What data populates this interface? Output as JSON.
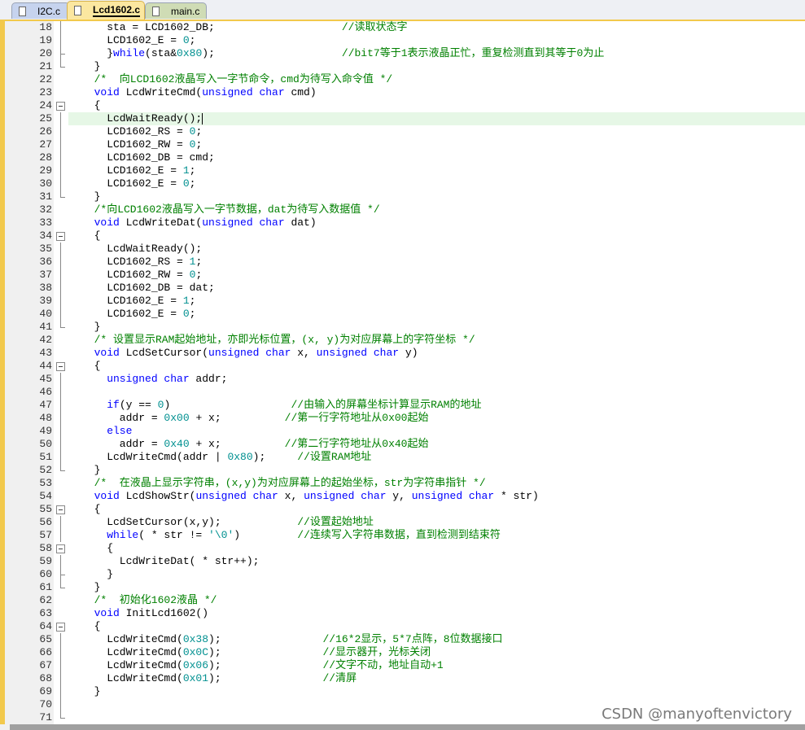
{
  "tabs": [
    {
      "label": "I2C.c",
      "icon": "file-icon"
    },
    {
      "label": "Lcd1602.c",
      "icon": "file-icon",
      "active": true
    },
    {
      "label": "main.c",
      "icon": "file-icon"
    }
  ],
  "colors": {
    "keyword": "#0000ff",
    "number": "#009090",
    "comment": "#008000",
    "current_line": "#e6f7e6",
    "accent": "#f2c94c"
  },
  "editor": {
    "current_line": 25,
    "lines": [
      {
        "n": 18,
        "f": "bar",
        "t": [
          [
            "n",
            "    sta = LCD1602_DB;                    "
          ],
          [
            "c",
            "//读取状态字"
          ]
        ]
      },
      {
        "n": 19,
        "f": "bar",
        "t": [
          [
            "n",
            "    LCD1602_E = "
          ],
          [
            "d",
            "0"
          ],
          [
            "n",
            ";"
          ]
        ]
      },
      {
        "n": 20,
        "f": "tick",
        "t": [
          [
            "n",
            "    }"
          ],
          [
            "k",
            "while"
          ],
          [
            "n",
            "(sta&"
          ],
          [
            "d",
            "0x80"
          ],
          [
            "n",
            ");                    "
          ],
          [
            "c",
            "//bit7等于1表示液晶正忙，重复检测直到其等于0为止"
          ]
        ]
      },
      {
        "n": 21,
        "f": "end",
        "t": [
          [
            "n",
            "  }"
          ]
        ]
      },
      {
        "n": 22,
        "f": "",
        "t": [
          [
            "c",
            "  /*  向LCD1602液晶写入一字节命令，cmd为待写入命令值 */"
          ]
        ]
      },
      {
        "n": 23,
        "f": "",
        "t": [
          [
            "k",
            "  void"
          ],
          [
            "n",
            " LcdWriteCmd("
          ],
          [
            "k",
            "unsigned char"
          ],
          [
            "n",
            " cmd)"
          ]
        ]
      },
      {
        "n": 24,
        "f": "minus",
        "t": [
          [
            "n",
            "  {"
          ]
        ]
      },
      {
        "n": 25,
        "f": "bar",
        "t": [
          [
            "n",
            "    LcdWaitReady();"
          ]
        ],
        "caret": true
      },
      {
        "n": 26,
        "f": "bar",
        "t": [
          [
            "n",
            "    LCD1602_RS = "
          ],
          [
            "d",
            "0"
          ],
          [
            "n",
            ";"
          ]
        ]
      },
      {
        "n": 27,
        "f": "bar",
        "t": [
          [
            "n",
            "    LCD1602_RW = "
          ],
          [
            "d",
            "0"
          ],
          [
            "n",
            ";"
          ]
        ]
      },
      {
        "n": 28,
        "f": "bar",
        "t": [
          [
            "n",
            "    LCD1602_DB = cmd;"
          ]
        ]
      },
      {
        "n": 29,
        "f": "bar",
        "t": [
          [
            "n",
            "    LCD1602_E = "
          ],
          [
            "d",
            "1"
          ],
          [
            "n",
            ";"
          ]
        ]
      },
      {
        "n": 30,
        "f": "bar",
        "t": [
          [
            "n",
            "    LCD1602_E = "
          ],
          [
            "d",
            "0"
          ],
          [
            "n",
            ";"
          ]
        ]
      },
      {
        "n": 31,
        "f": "end",
        "t": [
          [
            "n",
            "  }"
          ]
        ]
      },
      {
        "n": 32,
        "f": "",
        "t": [
          [
            "c",
            "  /*向LCD1602液晶写入一字节数据，dat为待写入数据值 */"
          ]
        ]
      },
      {
        "n": 33,
        "f": "",
        "t": [
          [
            "k",
            "  void"
          ],
          [
            "n",
            " LcdWriteDat("
          ],
          [
            "k",
            "unsigned char"
          ],
          [
            "n",
            " dat)"
          ]
        ]
      },
      {
        "n": 34,
        "f": "minus",
        "t": [
          [
            "n",
            "  {"
          ]
        ]
      },
      {
        "n": 35,
        "f": "bar",
        "t": [
          [
            "n",
            "    LcdWaitReady();"
          ]
        ]
      },
      {
        "n": 36,
        "f": "bar",
        "t": [
          [
            "n",
            "    LCD1602_RS = "
          ],
          [
            "d",
            "1"
          ],
          [
            "n",
            ";"
          ]
        ]
      },
      {
        "n": 37,
        "f": "bar",
        "t": [
          [
            "n",
            "    LCD1602_RW = "
          ],
          [
            "d",
            "0"
          ],
          [
            "n",
            ";"
          ]
        ]
      },
      {
        "n": 38,
        "f": "bar",
        "t": [
          [
            "n",
            "    LCD1602_DB = dat;"
          ]
        ]
      },
      {
        "n": 39,
        "f": "bar",
        "t": [
          [
            "n",
            "    LCD1602_E = "
          ],
          [
            "d",
            "1"
          ],
          [
            "n",
            ";"
          ]
        ]
      },
      {
        "n": 40,
        "f": "bar",
        "t": [
          [
            "n",
            "    LCD1602_E = "
          ],
          [
            "d",
            "0"
          ],
          [
            "n",
            ";"
          ]
        ]
      },
      {
        "n": 41,
        "f": "end",
        "t": [
          [
            "n",
            "  }"
          ]
        ]
      },
      {
        "n": 42,
        "f": "",
        "t": [
          [
            "c",
            "  /* 设置显示RAM起始地址，亦即光标位置，(x, y)为对应屏幕上的字符坐标 */"
          ]
        ]
      },
      {
        "n": 43,
        "f": "",
        "t": [
          [
            "k",
            "  void"
          ],
          [
            "n",
            " LcdSetCursor("
          ],
          [
            "k",
            "unsigned char"
          ],
          [
            "n",
            " x, "
          ],
          [
            "k",
            "unsigned char"
          ],
          [
            "n",
            " y)"
          ]
        ]
      },
      {
        "n": 44,
        "f": "minus",
        "t": [
          [
            "n",
            "  {"
          ]
        ]
      },
      {
        "n": 45,
        "f": "bar",
        "t": [
          [
            "k",
            "    unsigned char"
          ],
          [
            "n",
            " addr;"
          ]
        ]
      },
      {
        "n": 46,
        "f": "bar",
        "t": [
          [
            "n",
            ""
          ]
        ]
      },
      {
        "n": 47,
        "f": "bar",
        "t": [
          [
            "k",
            "    if"
          ],
          [
            "n",
            "(y == "
          ],
          [
            "d",
            "0"
          ],
          [
            "n",
            ")                   "
          ],
          [
            "c",
            "//由输入的屏幕坐标计算显示RAM的地址"
          ]
        ]
      },
      {
        "n": 48,
        "f": "bar",
        "t": [
          [
            "n",
            "      addr = "
          ],
          [
            "d",
            "0x00"
          ],
          [
            "n",
            " + x;          "
          ],
          [
            "c",
            "//第一行字符地址从0x00起始"
          ]
        ]
      },
      {
        "n": 49,
        "f": "bar",
        "t": [
          [
            "k",
            "    else"
          ]
        ]
      },
      {
        "n": 50,
        "f": "bar",
        "t": [
          [
            "n",
            "      addr = "
          ],
          [
            "d",
            "0x40"
          ],
          [
            "n",
            " + x;          "
          ],
          [
            "c",
            "//第二行字符地址从0x40起始"
          ]
        ]
      },
      {
        "n": 51,
        "f": "bar",
        "t": [
          [
            "n",
            "    LcdWriteCmd(addr | "
          ],
          [
            "d",
            "0x80"
          ],
          [
            "n",
            ");     "
          ],
          [
            "c",
            "//设置RAM地址"
          ]
        ]
      },
      {
        "n": 52,
        "f": "end",
        "t": [
          [
            "n",
            "  }"
          ]
        ]
      },
      {
        "n": 53,
        "f": "",
        "t": [
          [
            "c",
            "  /*  在液晶上显示字符串，(x,y)为对应屏幕上的起始坐标，str为字符串指针 */"
          ]
        ]
      },
      {
        "n": 54,
        "f": "",
        "t": [
          [
            "k",
            "  void"
          ],
          [
            "n",
            " LcdShowStr("
          ],
          [
            "k",
            "unsigned char"
          ],
          [
            "n",
            " x, "
          ],
          [
            "k",
            "unsigned char"
          ],
          [
            "n",
            " y, "
          ],
          [
            "k",
            "unsigned char"
          ],
          [
            "n",
            " * str)"
          ]
        ]
      },
      {
        "n": 55,
        "f": "minus",
        "t": [
          [
            "n",
            "  {"
          ]
        ]
      },
      {
        "n": 56,
        "f": "bar",
        "t": [
          [
            "n",
            "    LcdSetCursor(x,y);            "
          ],
          [
            "c",
            "//设置起始地址"
          ]
        ]
      },
      {
        "n": 57,
        "f": "bar",
        "t": [
          [
            "k",
            "    while"
          ],
          [
            "n",
            "( * str != "
          ],
          [
            "d",
            "'\\0'"
          ],
          [
            "n",
            ")         "
          ],
          [
            "c",
            "//连续写入字符串数据，直到检测到结束符"
          ]
        ]
      },
      {
        "n": 58,
        "f": "minus",
        "t": [
          [
            "n",
            "    {"
          ]
        ]
      },
      {
        "n": 59,
        "f": "bar",
        "t": [
          [
            "n",
            "      LcdWriteDat( * str++);"
          ]
        ]
      },
      {
        "n": 60,
        "f": "tick",
        "t": [
          [
            "n",
            "    }"
          ]
        ]
      },
      {
        "n": 61,
        "f": "end",
        "t": [
          [
            "n",
            "  }"
          ]
        ]
      },
      {
        "n": 62,
        "f": "",
        "t": [
          [
            "c",
            "  /*  初始化1602液晶 */"
          ]
        ]
      },
      {
        "n": 63,
        "f": "",
        "t": [
          [
            "k",
            "  void"
          ],
          [
            "n",
            " InitLcd1602()"
          ]
        ]
      },
      {
        "n": 64,
        "f": "minus",
        "t": [
          [
            "n",
            "  {"
          ]
        ]
      },
      {
        "n": 65,
        "f": "bar",
        "t": [
          [
            "n",
            "    LcdWriteCmd("
          ],
          [
            "d",
            "0x38"
          ],
          [
            "n",
            ");                "
          ],
          [
            "c",
            "//16*2显示，5*7点阵，8位数据接口"
          ]
        ]
      },
      {
        "n": 66,
        "f": "bar",
        "t": [
          [
            "n",
            "    LcdWriteCmd("
          ],
          [
            "d",
            "0x0C"
          ],
          [
            "n",
            ");                "
          ],
          [
            "c",
            "//显示器开，光标关闭"
          ]
        ]
      },
      {
        "n": 67,
        "f": "bar",
        "t": [
          [
            "n",
            "    LcdWriteCmd("
          ],
          [
            "d",
            "0x06"
          ],
          [
            "n",
            ");                "
          ],
          [
            "c",
            "//文字不动，地址自动+1"
          ]
        ]
      },
      {
        "n": 68,
        "f": "bar",
        "t": [
          [
            "n",
            "    LcdWriteCmd("
          ],
          [
            "d",
            "0x01"
          ],
          [
            "n",
            ");                "
          ],
          [
            "c",
            "//清屏"
          ]
        ]
      },
      {
        "n": 69,
        "f": "bar",
        "t": [
          [
            "n",
            "  }"
          ]
        ]
      },
      {
        "n": 70,
        "f": "bar",
        "t": [
          [
            "n",
            ""
          ]
        ]
      },
      {
        "n": 71,
        "f": "end",
        "t": [
          [
            "n",
            ""
          ]
        ]
      }
    ]
  },
  "watermark": "CSDN @manyoftenvictory"
}
